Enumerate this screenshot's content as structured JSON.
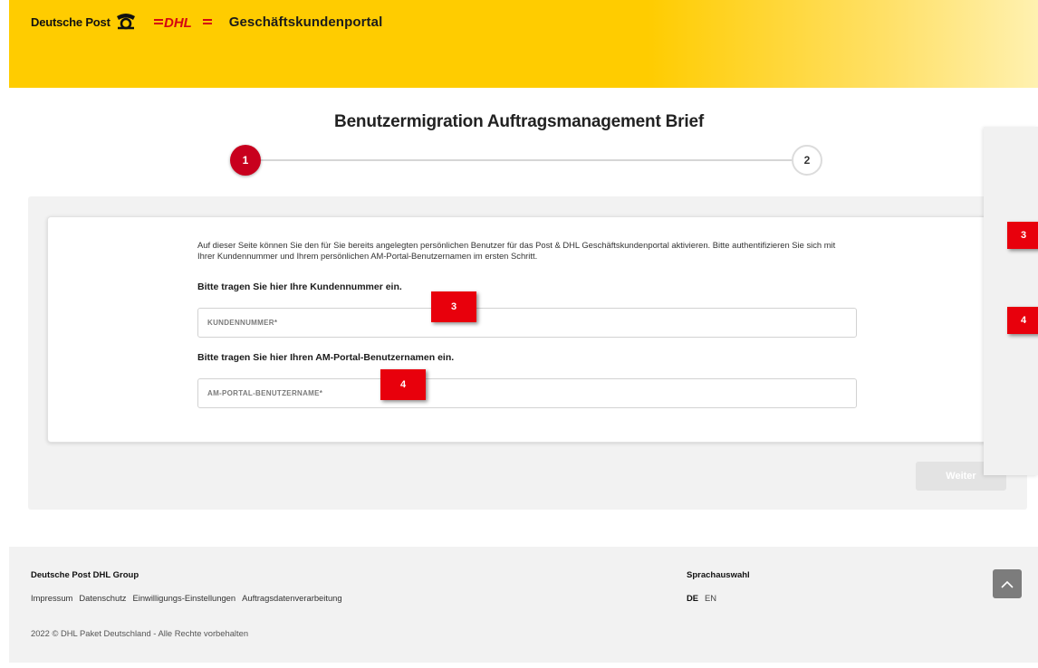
{
  "header": {
    "brand_text": "Deutsche Post",
    "logo_text": "DHL",
    "portal_title": "Geschäftskundenportal"
  },
  "page": {
    "title": "Benutzermigration Auftragsmanagement Brief",
    "steps": [
      "1",
      "2"
    ],
    "intro": "Auf dieser Seite können Sie den für Sie bereits angelegten persönlichen Benutzer für das Post & DHL Geschäftskundenportal aktivieren. Bitte authentifizieren Sie sich mit Ihrer Kundennummer und Ihrem persönlichen AM-Portal-Benutzernamen im ersten Schritt.",
    "customer_number_label": "Bitte tragen Sie hier Ihre Kundennummer ein.",
    "customer_number_placeholder": "KUNDENNUMMER*",
    "username_label": "Bitte tragen Sie hier Ihren AM-Portal-Benutzernamen ein.",
    "username_placeholder": "AM-PORTAL-BENUTZERNAME*",
    "next_label": "Weiter"
  },
  "markers": [
    "3",
    "4",
    "3",
    "4"
  ],
  "footer": {
    "group": "Deutsche Post DHL Group",
    "links": [
      "Impressum",
      "Datenschutz",
      "Einwilligungs-Einstellungen",
      "Auftragsdatenverarbeitung"
    ],
    "copyright": "2022 © DHL Paket Deutschland - Alle Rechte vorbehalten",
    "language_heading": "Sprachauswahl",
    "languages": [
      "DE",
      "EN"
    ]
  },
  "colors": {
    "header_yellow": "#ffcc00",
    "step_active": "#c8001e",
    "marker_red": "#e8000c",
    "dhl_red": "#d40511"
  }
}
